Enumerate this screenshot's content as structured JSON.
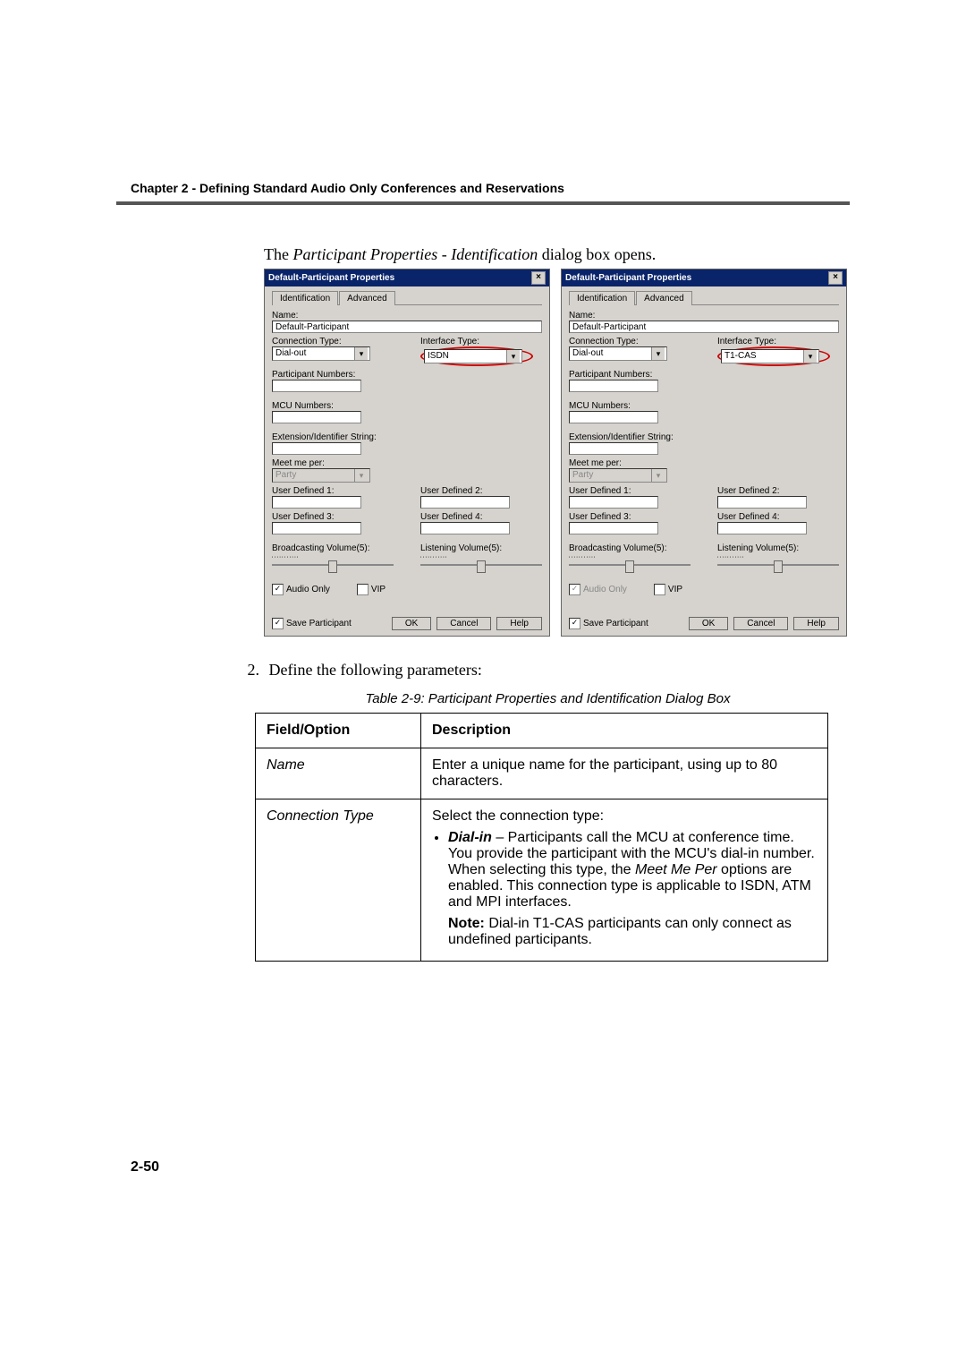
{
  "header": "Chapter 2 - Defining Standard Audio Only Conferences and Reservations",
  "intro_prefix": "The ",
  "intro_italic": "Participant Properties - Identification",
  "intro_suffix": " dialog box opens.",
  "dialog": {
    "title": "Default-Participant Properties",
    "tabs": {
      "active": "Identification",
      "other": "Advanced"
    },
    "labels": {
      "name": "Name:",
      "conn_type": "Connection Type:",
      "iface_type": "Interface Type:",
      "part_nums": "Participant Numbers:",
      "mcu_nums": "MCU Numbers:",
      "ext_id": "Extension/Identifier String:",
      "meet_me": "Meet me per:",
      "ud1": "User Defined 1:",
      "ud2": "User Defined 2:",
      "ud3": "User Defined 3:",
      "ud4": "User Defined 4:",
      "bcast_vol": "Broadcasting Volume(5):",
      "listen_vol": "Listening Volume(5):",
      "audio_only": "Audio Only",
      "vip": "VIP",
      "save_part": "Save Participant"
    },
    "values": {
      "name": "Default-Participant",
      "conn_type": "Dial-out",
      "meet_me": "Party"
    },
    "iface_left": "ISDN",
    "iface_right": "T1-CAS",
    "buttons": {
      "ok": "OK",
      "cancel": "Cancel",
      "help": "Help"
    }
  },
  "step2_num": "2.",
  "step2_text": "Define the following parameters:",
  "table_caption": "Table 2-9: Participant Properties and Identification Dialog Box",
  "table": {
    "head_field": "Field/Option",
    "head_desc": "Description",
    "rows": [
      {
        "field": "Name",
        "desc_plain": "Enter a unique name for the participant, using up to 80 characters."
      },
      {
        "field": "Connection Type",
        "lead": "Select the connection type:",
        "bullet_bi": "Dial-in",
        "bullet_rest": " – Participants call the MCU at conference time. You provide the participant with the MCU's dial-in number. When selecting this type, the ",
        "bullet_it": "Meet Me Per",
        "bullet_tail": " options are enabled. This connection type is applicable to ISDN, ATM and MPI interfaces.",
        "note_b": "Note:",
        "note_rest": " Dial-in T1-CAS participants can only connect as undefined participants."
      }
    ]
  },
  "page_number": "2-50"
}
